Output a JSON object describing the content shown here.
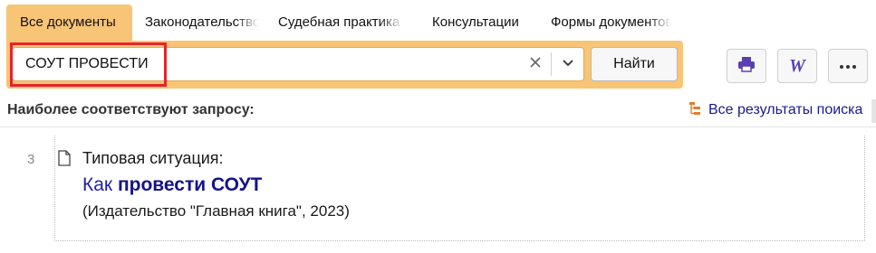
{
  "tabs": [
    {
      "label": "Все документы",
      "active": true
    },
    {
      "label": "Законодательство",
      "active": false
    },
    {
      "label": "Судебная практика",
      "active": false
    },
    {
      "label": "Консультации",
      "active": false
    },
    {
      "label": "Формы документов",
      "active": false
    }
  ],
  "search": {
    "value": "СОУТ ПРОВЕСТИ",
    "find_label": "Найти",
    "clear_icon": "close-icon",
    "dropdown_icon": "chevron-down-icon"
  },
  "toolbar": {
    "print_icon": "printer-icon",
    "word_label": "W",
    "more_icon": "more-icon"
  },
  "results": {
    "heading": "Наиболее соответствуют запросу:",
    "all_results_label": "Все результаты поиска",
    "items": [
      {
        "number": "3",
        "type": "Типовая ситуация:",
        "title_prefix": "Как ",
        "title_bold": "провести СОУТ",
        "source": "(Издательство \"Главная книга\", 2023)"
      }
    ]
  },
  "colors": {
    "accent": "#f8c476",
    "highlight_border": "#e8232a",
    "link": "#1f1fa8",
    "icon_orange": "#e8792b",
    "icon_purple": "#5a3fb0"
  }
}
